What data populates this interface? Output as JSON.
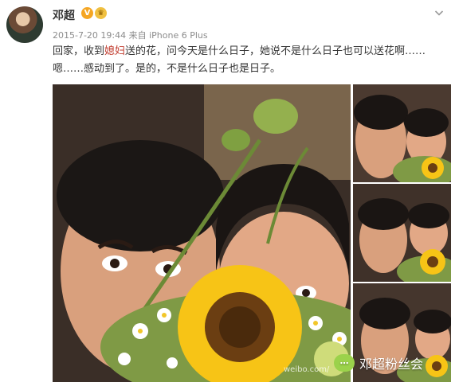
{
  "user": {
    "name": "邓超",
    "verified_badge": "V",
    "member_badge": "♛"
  },
  "post": {
    "meta": "2015-7-20 19:44 来自 iPhone 6 Plus",
    "text_before": "回家，收到",
    "text_highlight": "媳妇",
    "text_after": "送的花，问今天是什么日子，她说不是什么日子也可以送花啊……嗯……感动到了。是的，不是什么日子也是日子。"
  },
  "image": {
    "url_text": "weibo.com/",
    "watermark_text": "邓超粉丝会"
  },
  "icons": {
    "avatar": "avatar-photo",
    "verified": "verified-v-icon",
    "member": "crown-icon",
    "menu": "chevron-down-icon",
    "wechat": "wechat-icon"
  },
  "colors": {
    "highlight_text": "#c0392b",
    "meta_text": "#8c8c8c"
  }
}
